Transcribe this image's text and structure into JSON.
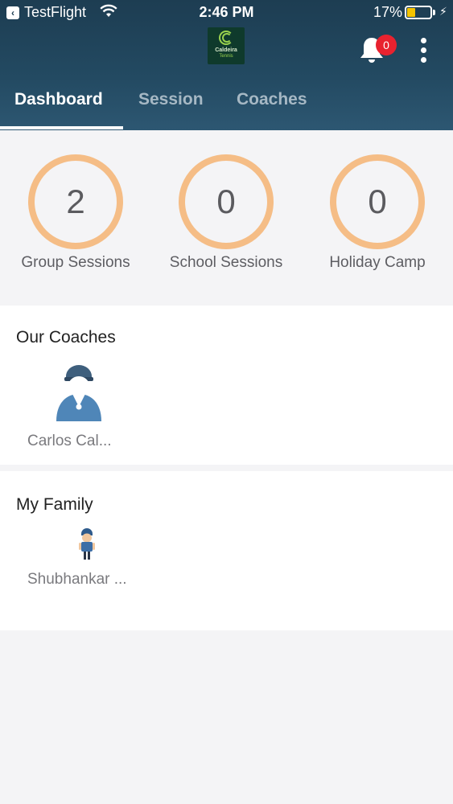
{
  "status_bar": {
    "back_app": "TestFlight",
    "time": "2:46 PM",
    "battery": "17%",
    "battery_level": 0.17
  },
  "header": {
    "logo_line1": "Caldeira",
    "logo_line2": "Tennis",
    "notification_count": "0",
    "colors": {
      "bar": "#1d3d52",
      "badge": "#e8222f",
      "ring": "#f5bd86"
    }
  },
  "tabs": [
    {
      "label": "Dashboard",
      "active": true
    },
    {
      "label": "Session",
      "active": false
    },
    {
      "label": "Coaches",
      "active": false
    }
  ],
  "stats": [
    {
      "value": "2",
      "label": "Group Sessions"
    },
    {
      "value": "0",
      "label": "School Sessions"
    },
    {
      "value": "0",
      "label": "Holiday Camp"
    }
  ],
  "coaches": {
    "title": "Our Coaches",
    "items": [
      {
        "name": "Carlos Cal...",
        "icon": "coach-avatar-icon"
      }
    ]
  },
  "family": {
    "title": "My Family",
    "items": [
      {
        "name": "Shubhankar ...",
        "icon": "child-avatar-icon"
      }
    ]
  }
}
